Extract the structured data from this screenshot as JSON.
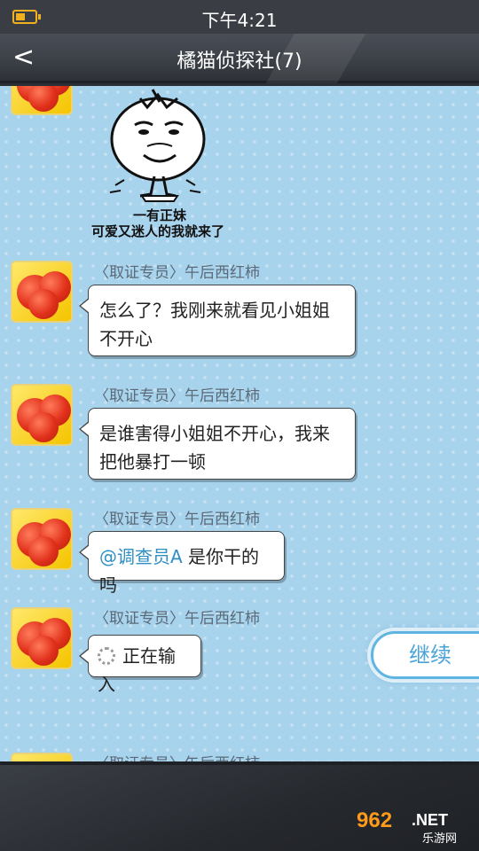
{
  "status_bar": {
    "time": "下午4:21",
    "battery_level": 0.5
  },
  "header": {
    "back_label": "<",
    "title": "橘猫侦探社(7)"
  },
  "sticker": {
    "line1": "一有正妹",
    "line2": "可爱又迷人的我就来了"
  },
  "messages": [
    {
      "sender": "〈取证专员〉午后西红柿",
      "text": "怎么了？我刚来就看见小姐姐不开心"
    },
    {
      "sender": "〈取证专员〉午后西红柿",
      "text": "是谁害得小姐姐不开心，我来把他暴打一顿"
    },
    {
      "sender": "〈取证专员〉午后西红柿",
      "mention": "@调查员A",
      "text": " 是你干的吗"
    },
    {
      "sender": "〈取证专员〉午后西红柿",
      "text": "正在输入"
    },
    {
      "sender": "〈取证专员〉午后西红柿"
    }
  ],
  "continue_label": "继续",
  "watermark": {
    "logo": "962",
    "tld": ".NET",
    "site": "乐游网"
  },
  "colors": {
    "chat_bg": "#a8d3ec",
    "mention": "#2f8fc4",
    "accent": "#5fb4e2"
  }
}
